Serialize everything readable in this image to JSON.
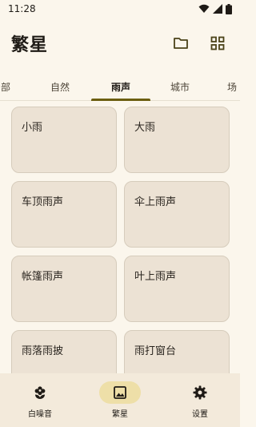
{
  "status": {
    "time": "11:28"
  },
  "app": {
    "title": "繁星"
  },
  "tabs": [
    {
      "label": "部"
    },
    {
      "label": "自然"
    },
    {
      "label": "雨声"
    },
    {
      "label": "城市"
    },
    {
      "label": "场"
    }
  ],
  "cards": [
    {
      "label": "小雨"
    },
    {
      "label": "大雨"
    },
    {
      "label": "车顶雨声"
    },
    {
      "label": "伞上雨声"
    },
    {
      "label": "帐篷雨声"
    },
    {
      "label": "叶上雨声"
    },
    {
      "label": "雨落雨披"
    },
    {
      "label": "雨打窗台"
    }
  ],
  "nav": [
    {
      "label": "白噪音",
      "icon": "flower-icon"
    },
    {
      "label": "繁星",
      "icon": "image-icon"
    },
    {
      "label": "设置",
      "icon": "gear-icon"
    }
  ],
  "colors": {
    "accent": "#6c5e10",
    "card": "#ece2d4",
    "background": "#fbf6ec",
    "nav_pill": "#eedfa8"
  }
}
